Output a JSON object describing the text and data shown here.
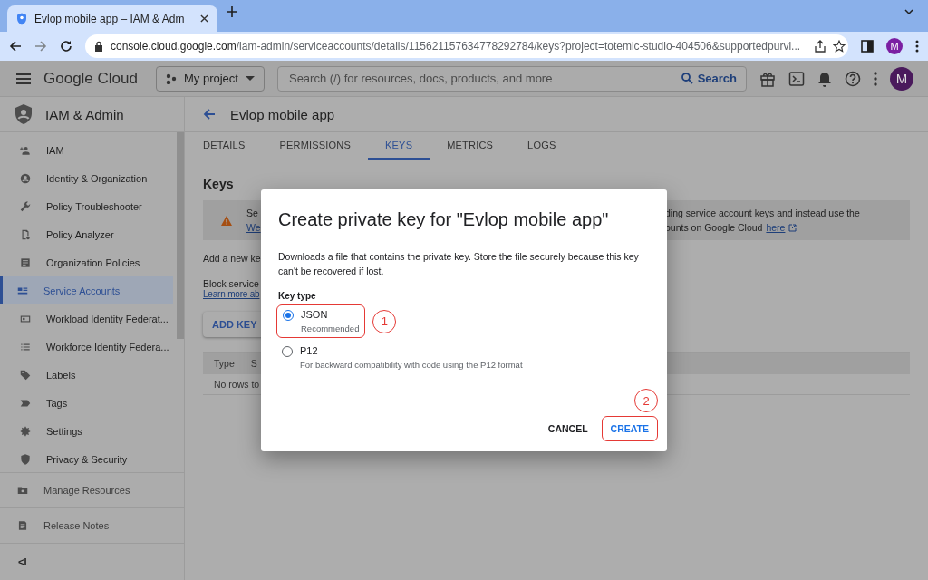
{
  "browser": {
    "tabs": [
      {
        "title": "Evlop mobile app – IAM & Adm",
        "selected": true
      }
    ],
    "url_host": "console.cloud.google.com",
    "url_path": "/iam-admin/serviceaccounts/details/115621157634778292784/keys?project=totemic-studio-404506&supportedpurvi...",
    "profile": "M"
  },
  "header": {
    "logo_word_1": "Google",
    "logo_word_2": "Cloud",
    "project": "My project",
    "search": {
      "placeholder": "Search (/) for resources, docs, products, and more",
      "button": "Search"
    },
    "avatar": "M"
  },
  "sidebar": {
    "title": "IAM & Admin",
    "items": [
      {
        "label": "IAM",
        "selected": false
      },
      {
        "label": "Identity & Organization",
        "selected": false
      },
      {
        "label": "Policy Troubleshooter",
        "selected": false
      },
      {
        "label": "Policy Analyzer",
        "selected": false
      },
      {
        "label": "Organization Policies",
        "selected": false
      },
      {
        "label": "Service Accounts",
        "selected": true
      },
      {
        "label": "Workload Identity Federat...",
        "selected": false
      },
      {
        "label": "Workforce Identity Federa...",
        "selected": false
      },
      {
        "label": "Labels",
        "selected": false
      },
      {
        "label": "Tags",
        "selected": false
      },
      {
        "label": "Settings",
        "selected": false
      },
      {
        "label": "Privacy & Security",
        "selected": false
      }
    ],
    "footer": [
      {
        "label": "Manage Resources"
      },
      {
        "label": "Release Notes"
      }
    ],
    "collapse": "<I"
  },
  "page": {
    "title": "Evlop mobile app",
    "tabs": [
      {
        "label": "DETAILS",
        "selected": false
      },
      {
        "label": "PERMISSIONS",
        "selected": false
      },
      {
        "label": "KEYS",
        "selected": true
      },
      {
        "label": "METRICS",
        "selected": false
      },
      {
        "label": "LOGS",
        "selected": false
      }
    ],
    "heading": "Keys",
    "banner": {
      "text_left": "Se",
      "link_left": "We",
      "text_right_1": "ding service account keys and instead use the",
      "text_right_2": "ounts on Google Cloud",
      "link_right": "here"
    },
    "add_text": "Add a new ke",
    "block_text": "Block service",
    "learn_link": "Learn more ab",
    "add_key": "ADD KEY",
    "table": {
      "columns": [
        "Type",
        "S"
      ],
      "empty": "No rows to"
    }
  },
  "dialog": {
    "title": "Create private key for \"Evlop mobile app\"",
    "description": "Downloads a file that contains the private key. Store the file securely because this key can't be recovered if lost.",
    "key_type_label": "Key type",
    "options": [
      {
        "label": "JSON",
        "hint": "Recommended",
        "selected": true
      },
      {
        "label": "P12",
        "hint": "For backward compatibility with code using the P12 format",
        "selected": false
      }
    ],
    "buttons": [
      {
        "label": "CANCEL",
        "kind": "text"
      },
      {
        "label": "CREATE",
        "kind": "primary"
      }
    ]
  },
  "annotations": [
    {
      "number": "1"
    },
    {
      "number": "2"
    }
  ]
}
